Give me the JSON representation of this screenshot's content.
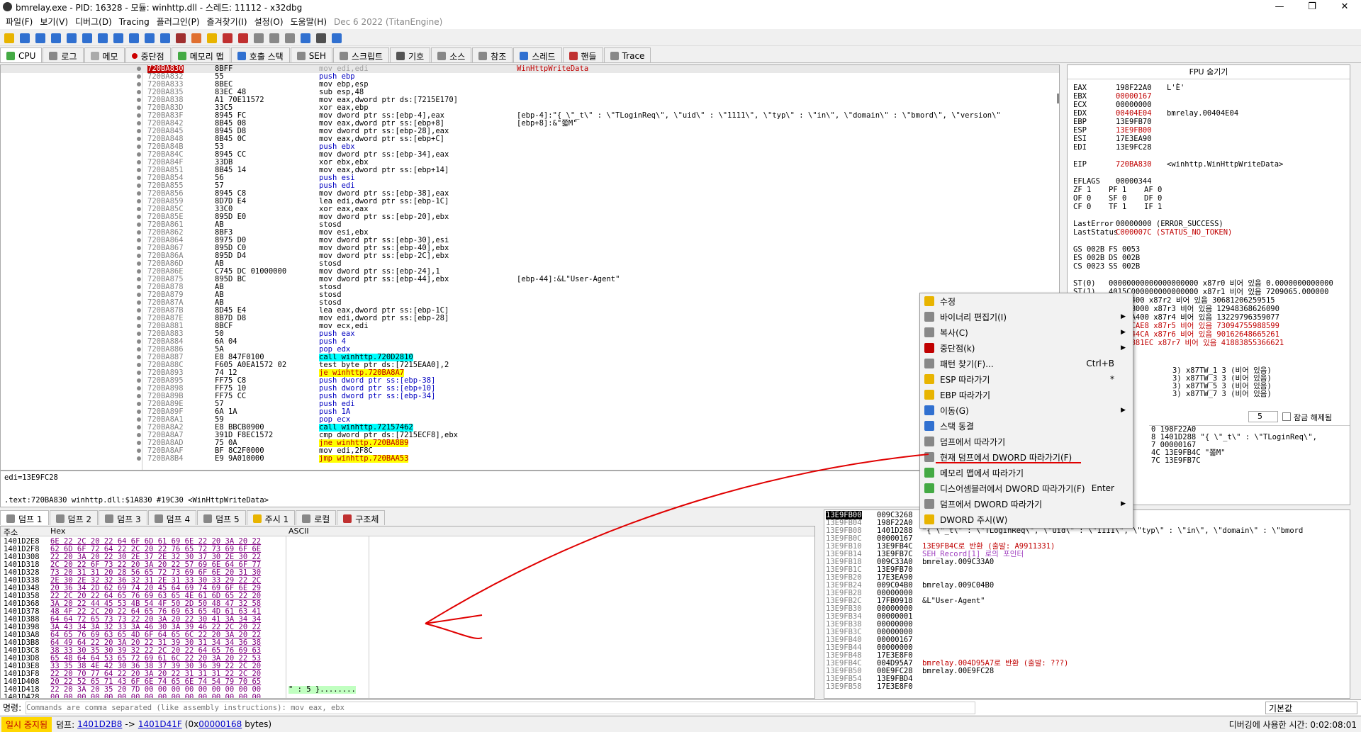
{
  "title": {
    "text": "bmrelay.exe - PID: 16328 - 모듈: winhttp.dll - 스레드: 11112 - x32dbg"
  },
  "window": {
    "minimize": "—",
    "maximize": "❐",
    "close": "✕"
  },
  "menu": {
    "items": [
      "파일(F)",
      "보기(V)",
      "디버그(D)",
      "Tracing",
      "플러그인(P)",
      "즐겨찾기(I)",
      "설정(O)",
      "도움말(H)"
    ],
    "date": "Dec 6 2022 (TitanEngine)"
  },
  "tabs": [
    "CPU",
    "로그",
    "메모",
    "중단점",
    "메모리 맵",
    "호출 스택",
    "SEH",
    "스크립트",
    "기호",
    "소스",
    "참조",
    "스레드",
    "핸들",
    "Trace"
  ],
  "disasm": [
    {
      "a": "720BA830",
      "b": "8BFF",
      "d": "mov edi,edi",
      "c": "WinHttpWriteData"
    },
    {
      "a": "720BA832",
      "b": "55",
      "d": "push ebp",
      "c": ""
    },
    {
      "a": "720BA833",
      "b": "8BEC",
      "d": "mov ebp,esp",
      "c": ""
    },
    {
      "a": "720BA835",
      "b": "83EC 48",
      "d": "sub esp,48",
      "c": ""
    },
    {
      "a": "720BA838",
      "b": "A1 70E11572",
      "d": "mov eax,dword ptr ds:[7215E170]",
      "c": ""
    },
    {
      "a": "720BA83D",
      "b": "33C5",
      "d": "xor eax,ebp",
      "c": ""
    },
    {
      "a": "720BA83F",
      "b": "8945 FC",
      "d": "mov dword ptr ss:[ebp-4],eax",
      "c": "[ebp-4]:\"{ \\\"_t\\\" : \\\"TLoginReq\\\", \\\"uid\\\" : \\\"1111\\\", \\\"typ\\\" : \\\"in\\\", \\\"domain\\\" : \\\"bmord\\\", \\\"version\\\""
    },
    {
      "a": "720BA842",
      "b": "8B45 08",
      "d": "mov eax,dword ptr ss:[ebp+8]",
      "c": "[ebp+8]:&\"쫇M\""
    },
    {
      "a": "720BA845",
      "b": "8945 D8",
      "d": "mov dword ptr ss:[ebp-28],eax",
      "c": ""
    },
    {
      "a": "720BA848",
      "b": "8B45 0C",
      "d": "mov eax,dword ptr ss:[ebp+C]",
      "c": ""
    },
    {
      "a": "720BA84B",
      "b": "53",
      "d": "push ebx",
      "c": ""
    },
    {
      "a": "720BA84C",
      "b": "8945 CC",
      "d": "mov dword ptr ss:[ebp-34],eax",
      "c": ""
    },
    {
      "a": "720BA84F",
      "b": "33DB",
      "d": "xor ebx,ebx",
      "c": ""
    },
    {
      "a": "720BA851",
      "b": "8B45 14",
      "d": "mov eax,dword ptr ss:[ebp+14]",
      "c": ""
    },
    {
      "a": "720BA854",
      "b": "56",
      "d": "push esi",
      "c": ""
    },
    {
      "a": "720BA855",
      "b": "57",
      "d": "push edi",
      "c": ""
    },
    {
      "a": "720BA856",
      "b": "8945 C8",
      "d": "mov dword ptr ss:[ebp-38],eax",
      "c": ""
    },
    {
      "a": "720BA859",
      "b": "8D7D E4",
      "d": "lea edi,dword ptr ss:[ebp-1C]",
      "c": ""
    },
    {
      "a": "720BA85C",
      "b": "33C0",
      "d": "xor eax,eax",
      "c": ""
    },
    {
      "a": "720BA85E",
      "b": "895D E0",
      "d": "mov dword ptr ss:[ebp-20],ebx",
      "c": ""
    },
    {
      "a": "720BA861",
      "b": "AB",
      "d": "stosd",
      "c": ""
    },
    {
      "a": "720BA862",
      "b": "8BF3",
      "d": "mov esi,ebx",
      "c": ""
    },
    {
      "a": "720BA864",
      "b": "8975 D0",
      "d": "mov dword ptr ss:[ebp-30],esi",
      "c": ""
    },
    {
      "a": "720BA867",
      "b": "895D C0",
      "d": "mov dword ptr ss:[ebp-40],ebx",
      "c": ""
    },
    {
      "a": "720BA86A",
      "b": "895D D4",
      "d": "mov dword ptr ss:[ebp-2C],ebx",
      "c": ""
    },
    {
      "a": "720BA86D",
      "b": "AB",
      "d": "stosd",
      "c": ""
    },
    {
      "a": "720BA86E",
      "b": "C745 DC 01000000",
      "d": "mov dword ptr ss:[ebp-24],1",
      "c": ""
    },
    {
      "a": "720BA875",
      "b": "895D BC",
      "d": "mov dword ptr ss:[ebp-44],ebx",
      "c": "[ebp-44]:&L\"User-Agent\""
    },
    {
      "a": "720BA878",
      "b": "AB",
      "d": "stosd",
      "c": ""
    },
    {
      "a": "720BA879",
      "b": "AB",
      "d": "stosd",
      "c": ""
    },
    {
      "a": "720BA87A",
      "b": "AB",
      "d": "stosd",
      "c": ""
    },
    {
      "a": "720BA87B",
      "b": "8D45 E4",
      "d": "lea eax,dword ptr ss:[ebp-1C]",
      "c": ""
    },
    {
      "a": "720BA87E",
      "b": "8B7D D8",
      "d": "mov edi,dword ptr ss:[ebp-28]",
      "c": ""
    },
    {
      "a": "720BA881",
      "b": "8BCF",
      "d": "mov ecx,edi",
      "c": ""
    },
    {
      "a": "720BA883",
      "b": "50",
      "d": "push eax",
      "c": ""
    },
    {
      "a": "720BA884",
      "b": "6A 04",
      "d": "push 4",
      "c": ""
    },
    {
      "a": "720BA886",
      "b": "5A",
      "d": "pop edx",
      "c": ""
    },
    {
      "a": "720BA887",
      "b": "E8 847F0100",
      "d": "call winhttp.720D2810",
      "c": ""
    },
    {
      "a": "720BA88C",
      "b": "F605 A0EA1572 02",
      "d": "test byte ptr ds:[7215EAA0],2",
      "c": ""
    },
    {
      "a": "720BA893",
      "b": "74 12",
      "d": "je winhttp.720BA8A7",
      "c": ""
    },
    {
      "a": "720BA895",
      "b": "FF75 C8",
      "d": "push dword ptr ss:[ebp-38]",
      "c": ""
    },
    {
      "a": "720BA898",
      "b": "FF75 10",
      "d": "push dword ptr ss:[ebp+10]",
      "c": ""
    },
    {
      "a": "720BA89B",
      "b": "FF75 CC",
      "d": "push dword ptr ss:[ebp-34]",
      "c": ""
    },
    {
      "a": "720BA89E",
      "b": "57",
      "d": "push edi",
      "c": ""
    },
    {
      "a": "720BA89F",
      "b": "6A 1A",
      "d": "push 1A",
      "c": ""
    },
    {
      "a": "720BA8A1",
      "b": "59",
      "d": "pop ecx",
      "c": ""
    },
    {
      "a": "720BA8A2",
      "b": "E8 BBCB0900",
      "d": "call winhttp.72157462",
      "c": ""
    },
    {
      "a": "720BA8A7",
      "b": "391D F8EC1572",
      "d": "cmp dword ptr ds:[7215ECF8],ebx",
      "c": ""
    },
    {
      "a": "720BA8AD",
      "b": "75 0A",
      "d": "jne winhttp.720BA8B9",
      "c": ""
    },
    {
      "a": "720BA8AF",
      "b": "BF 8C2F0000",
      "d": "mov edi,2F8C",
      "c": ""
    },
    {
      "a": "720BA8B4",
      "b": "E9 9A010000",
      "d": "jmp winhttp.720BAA53",
      "c": ""
    }
  ],
  "info": {
    "line1": "edi=13E9FC28",
    "line2": ".text:720BA830 winhttp.dll:$1A830 #19C30 <WinHttpWriteData>"
  },
  "registers": {
    "header": "FPU 숨기기",
    "lines": [
      [
        "EAX",
        "198F22A0",
        "L'È'"
      ],
      [
        "EBX",
        "00000167",
        ""
      ],
      [
        "ECX",
        "00000000",
        ""
      ],
      [
        "EDX",
        "00404E04",
        "bmrelay.00404E04"
      ],
      [
        "EBP",
        "13E9FB70",
        ""
      ],
      [
        "ESP",
        "13E9FB00",
        ""
      ],
      [
        "ESI",
        "17E3EA90",
        ""
      ],
      [
        "EDI",
        "13E9FC28",
        ""
      ],
      [
        "",
        "",
        " "
      ],
      [
        "EIP",
        "720BA830",
        "<winhttp.WinHttpWriteData>"
      ],
      [
        "",
        "",
        ""
      ],
      [
        "EFLAGS",
        "00000344",
        ""
      ],
      [
        "ZF 1",
        "PF 1",
        "AF 0"
      ],
      [
        "OF 0",
        "SF 0",
        "DF 0"
      ],
      [
        "CF 0",
        "TF 1",
        "IF 1"
      ],
      [
        "",
        "",
        ""
      ],
      [
        "LastError",
        "00000000 (ERROR_SUCCESS)",
        ""
      ],
      [
        "LastStatus",
        "C000007C (STATUS_NO_TOKEN)",
        ""
      ],
      [
        "",
        "",
        ""
      ],
      [
        "GS 002B",
        "FS 0053",
        ""
      ],
      [
        "ES 002B",
        "DS 002B",
        ""
      ],
      [
        "CS 0023",
        "SS 002B",
        ""
      ],
      [
        "",
        "",
        ""
      ],
      [
        "ST(0)",
        "00000000000000000000 x87r0 비어 있음 0.0000000000000",
        ""
      ],
      [
        "ST(1)",
        "4015C000000000000000 x87r1 비어 있음 7209065.000000",
        ""
      ],
      [
        "",
        "C200C400 x87r2 비어 있음 30681206259515",
        ""
      ],
      [
        "",
        "18401B000 x87r3 비어 있음 12948368626090",
        ""
      ],
      [
        "",
        "1BC01A400 x87r4 비어 있음 13229796359077",
        ""
      ],
      [
        "",
        "3E8DCCAE8 x87r5 비어 있음 73094755988599",
        ""
      ],
      [
        "",
        "0744044CA x87r6 비어 있음 90162648665261",
        ""
      ],
      [
        "",
        "70817881EC x87r7 비어 있음 41883855366621",
        ""
      ]
    ],
    "tags": [
      "3) x87TW_1 3 (비어 있음)",
      "3) x87TW_3 3 (비어 있음)",
      "3) x87TW_5 3 (비어 있음)",
      "3) x87TW_7 3 (비어 있음)"
    ],
    "callconv": "5",
    "unlock": "잠금 해제됨"
  },
  "callstack_snippet": [
    "0 198F22A0",
    "8 1401D288 \"{ \\\"_t\\\" : \\\"TLoginReq\\\",",
    "7 00000167",
    "4C 13E9FB4C \"쫇M\"",
    "7C 13E9FB7C"
  ],
  "dump_tabs": [
    "덤프 1",
    "덤프 2",
    "덤프 3",
    "덤프 4",
    "덤프 5",
    "주시 1",
    "로컬",
    "구조체"
  ],
  "dump": {
    "hdr_addr": "주소",
    "hdr_hex": "Hex",
    "hdr_ascii": "ASCII",
    "rows": [
      [
        "1401D2E8",
        "6E 22 2C 20 22 64 6F 6D 61 69 6E 22 20 3A 20 22"
      ],
      [
        "1401D2F8",
        "62 6D 6F 72 64 22 2C 20 22 76 65 72 73 69 6F 6E"
      ],
      [
        "1401D308",
        "22 20 3A 20 22 30 2E 37 2E 32 30 37 30 2E 30 22"
      ],
      [
        "1401D318",
        "2C 20 22 6F 73 22 20 3A 20 22 57 69 6E 64 6F 77"
      ],
      [
        "1401D328",
        "73 20 31 31 20 28 56 65 72 73 69 6F 6E 20 31 30"
      ],
      [
        "1401D338",
        "2E 30 2E 32 32 36 32 31 2E 31 33 30 33 29 22 2C"
      ],
      [
        "1401D348",
        "20 36 34 2D 62 69 74 20 45 64 69 74 69 6F 6E 29"
      ],
      [
        "1401D358",
        "22 2C 20 22 64 65 76 69 63 65 4E 61 6D 65 22 20"
      ],
      [
        "1401D368",
        "3A 20 22 44 45 53 4B 54 4F 50 2D 50 48 47 32 58"
      ],
      [
        "1401D378",
        "48 4F 22 2C 20 22 64 65 76 69 63 65 4D 61 63 41"
      ],
      [
        "1401D388",
        "64 64 72 65 73 73 22 20 3A 20 22 30 41 3A 34 34"
      ],
      [
        "1401D398",
        "3A 43 34 3A 32 33 3A 46 30 3A 39 46 22 2C 20 22"
      ],
      [
        "1401D3A8",
        "64 65 76 69 63 65 4D 6F 64 65 6C 22 20 3A 20 22"
      ],
      [
        "1401D3B8",
        "64 49 64 22 20 3A 20 22 31 39 30 31 34 34 36 38"
      ],
      [
        "1401D3C8",
        "38 33 30 35 30 39 32 22 2C 20 22 64 65 76 69 63"
      ],
      [
        "1401D3D8",
        "65 48 64 64 53 65 72 69 61 6C 22 20 3A 20 22 53"
      ],
      [
        "1401D3E8",
        "33 35 38 4E 42 30 36 38 37 39 30 36 39 22 2C 20"
      ],
      [
        "1401D3F8",
        "22 20 70 77 64 22 20 3A 20 22 31 31 31 22 2C 20"
      ],
      [
        "1401D408",
        "20 22 52 65 71 43 6F 6E 74 65 6E 74 54 79 70 65"
      ],
      [
        "1401D418",
        "22 20 3A 20 35 20 7D 00 00 00 00 00 00 00 00 00"
      ],
      [
        "1401D428",
        "00 00 00 00 00 00 00 00 00 00 00 00 00 00 00 00"
      ]
    ],
    "ascii_tail": "\" : 5 }........"
  },
  "stack": {
    "rows": [
      [
        "13E9FB00",
        "009C3268",
        ""
      ],
      [
        "13E9FB04",
        "198F22A0",
        ""
      ],
      [
        "13E9FB08",
        "1401D288",
        "\"{ \\\"_t\\\" : \\\"TLoginReq\\\", \\\"uid\\\" : \\\"1111\\\", \\\"typ\\\" : \\\"in\\\", \\\"domain\\\" : \\\"bmord"
      ],
      [
        "13E9FB0C",
        "00000167",
        ""
      ],
      [
        "13E9FB10",
        "13E9FB4C",
        "13E9FB4C로 반환 (출발: A9911331)"
      ],
      [
        "13E9FB14",
        "13E9FB7C",
        "SEH_Record[1] 로의 포인터"
      ],
      [
        "13E9FB18",
        "009C33A0",
        "bmrelay.009C33A0"
      ],
      [
        "13E9FB1C",
        "13E9FB70",
        ""
      ],
      [
        "13E9FB20",
        "17E3EA90",
        ""
      ],
      [
        "13E9FB24",
        "009C04B0",
        "bmrelay.009C04B0"
      ],
      [
        "13E9FB28",
        "00000000",
        ""
      ],
      [
        "13E9FB2C",
        "17FB0918",
        "&L\"User-Agent\""
      ],
      [
        "13E9FB30",
        "00000000",
        ""
      ],
      [
        "13E9FB34",
        "00000001",
        ""
      ],
      [
        "13E9FB38",
        "00000000",
        ""
      ],
      [
        "13E9FB3C",
        "00000000",
        ""
      ],
      [
        "13E9FB40",
        "00000167",
        ""
      ],
      [
        "13E9FB44",
        "00000000",
        ""
      ],
      [
        "13E9FB48",
        "17E3E8F0",
        ""
      ],
      [
        "13E9FB4C",
        "004D95A7",
        "bmrelay.004D95A7로 반환 (출발: ???)"
      ],
      [
        "13E9FB50",
        "00E9FC28",
        "bmrelay.00E9FC28"
      ],
      [
        "13E9FB54",
        "13E9FBD4",
        ""
      ],
      [
        "13E9FB58",
        "17E3E8F0",
        ""
      ]
    ]
  },
  "context_menu": [
    {
      "label": "수정",
      "sc": "",
      "sub": false
    },
    {
      "label": "바이너리 편집기(I)",
      "sc": "",
      "sub": true
    },
    {
      "label": "복사(C)",
      "sc": "",
      "sub": true
    },
    {
      "label": "중단점(k)",
      "sc": "",
      "sub": true
    },
    {
      "label": "패턴 찾기(F)...",
      "sc": "Ctrl+B",
      "sub": false
    },
    {
      "label": "ESP 따라가기",
      "sc": "*",
      "sub": false
    },
    {
      "label": "EBP 따라가기",
      "sc": "",
      "sub": false
    },
    {
      "label": "이동(G)",
      "sc": "",
      "sub": true
    },
    {
      "label": "스택 동결",
      "sc": "",
      "sub": false
    },
    {
      "label": "덤프에서 따라가기",
      "sc": "",
      "sub": false
    },
    {
      "label": "현재 덤프에서 DWORD 따라가기(F)",
      "sc": "",
      "sub": false
    },
    {
      "label": "메모리 맵에서 따라가기",
      "sc": "",
      "sub": false
    },
    {
      "label": "디스어셈블러에서 DWORD 따라가기(F)",
      "sc": "Enter",
      "sub": false
    },
    {
      "label": "덤프에서 DWORD 따라가기",
      "sc": "",
      "sub": true
    },
    {
      "label": "DWORD 주시(W)",
      "sc": "",
      "sub": false
    }
  ],
  "cmd": {
    "label": "명령:",
    "placeholder": "Commands are comma separated (like assembly instructions): mov eax, ebx",
    "dropdown": "기본값"
  },
  "status": {
    "state": "일시 중지됨",
    "dump_label": "덤프:",
    "range_start": "1401D2B8",
    "arrow": "->",
    "range_end": "1401D41F",
    "open": "(0x",
    "size": "00000168",
    "tail": "bytes)",
    "time": "디버깅에 사용한 시간: 0:02:08:01"
  },
  "colors": {
    "eip": "#4060ff",
    "highlight": "#ffff00",
    "bp": "#c00000",
    "annotation": "#e00000"
  }
}
